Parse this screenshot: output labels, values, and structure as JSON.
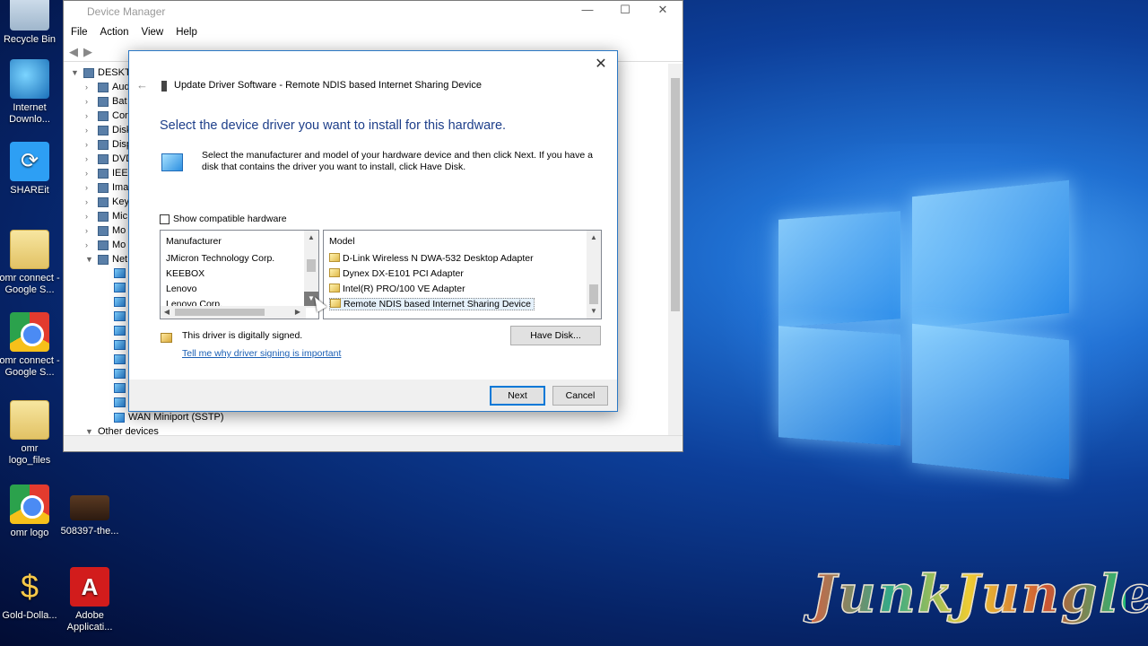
{
  "desktop": {
    "icons": [
      {
        "label": "Recycle Bin"
      },
      {
        "label": "Internet Downlo..."
      },
      {
        "label": "SHAREit"
      },
      {
        "label": "omr connect - Google S..."
      },
      {
        "label": "omr connect - Google S..."
      },
      {
        "label": "omr logo_files"
      },
      {
        "label": "omr logo"
      },
      {
        "label": "508397-the..."
      },
      {
        "label": "Gold-Dolla..."
      },
      {
        "label": "Adobe Applicati..."
      }
    ],
    "watermark": "JunkJungle"
  },
  "device_manager": {
    "title": "Device Manager",
    "menu": [
      "File",
      "Action",
      "View",
      "Help"
    ],
    "root": "DESKTO",
    "tree": [
      "Aud",
      "Bat",
      "Cor",
      "Disk",
      "Disp",
      "DVD",
      "IEEE",
      "Ima",
      "Key",
      "Mic",
      "Mo",
      "Mo",
      "Net"
    ],
    "wan_item": "WAN Miniport (SSTP)",
    "other": "Other devices"
  },
  "dialog": {
    "title": "Update Driver Software - Remote NDIS based Internet Sharing Device",
    "heading": "Select the device driver you want to install for this hardware.",
    "instructions": "Select the manufacturer and model of your hardware device and then click Next. If you have a disk that contains the driver you want to install, click Have Disk.",
    "show_compatible": "Show compatible hardware",
    "manufacturer_header": "Manufacturer",
    "manufacturers": [
      "JMicron Technology Corp.",
      "KEEBOX",
      "Lenovo",
      "Lenovo Corp."
    ],
    "model_header": "Model",
    "models": [
      "D-Link Wireless N DWA-532 Desktop Adapter",
      "Dynex DX-E101 PCI Adapter",
      "Intel(R) PRO/100 VE Adapter",
      "Remote NDIS based Internet Sharing Device"
    ],
    "signed_text": "This driver is digitally signed.",
    "signing_link": "Tell me why driver signing is important",
    "have_disk": "Have Disk...",
    "next": "Next",
    "cancel": "Cancel"
  }
}
